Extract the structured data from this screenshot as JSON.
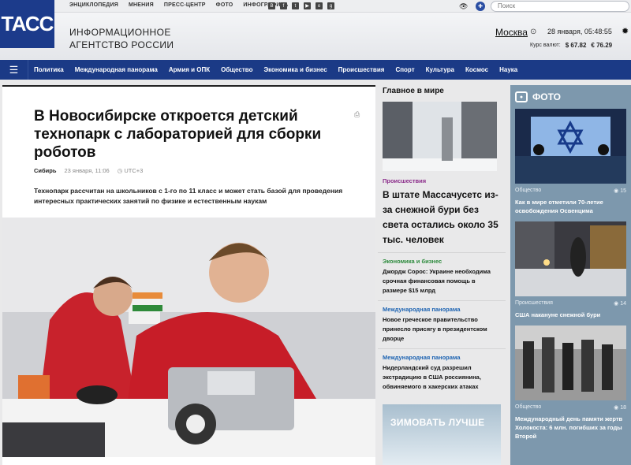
{
  "topbar": {
    "links": [
      "ЭНЦИКЛОПЕДИЯ",
      "МНЕНИЯ",
      "ПРЕСС-ЦЕНТР",
      "ФОТО",
      "ИНФОГРАФИКА"
    ],
    "social_icons": [
      "vk-icon",
      "facebook-icon",
      "twitter-icon",
      "youtube-icon",
      "odnoklassniki-icon",
      "googleplus-icon"
    ],
    "search_placeholder": "Поиск"
  },
  "header": {
    "logo": "ТАСС",
    "agency_line1": "ИНФОРМАЦИОННОЕ",
    "agency_line2": "АГЕНТСТВО РОССИИ",
    "city": "Москва",
    "datetime": "28 января, 05:48:55",
    "rates_label": "Курс валют:",
    "usd": "$ 67.82",
    "eur": "€ 76.29"
  },
  "nav": {
    "items": [
      "Политика",
      "Международная панорама",
      "Армия и ОПК",
      "Общество",
      "Экономика и бизнес",
      "Происшествия",
      "Спорт",
      "Культура",
      "Космос",
      "Наука"
    ]
  },
  "article": {
    "title": "В Новосибирске откроется детский технопарк с лабораторией для сборки роботов",
    "region": "Сибирь",
    "date": "23 января, 11:06",
    "tz": "UTC+3",
    "lead": "Технопарк рассчитан на школьников с 1-го по 11 класс и может стать базой для проведения интересных практических занятий по физике и естественным наукам"
  },
  "world": {
    "title": "Главное в мире",
    "top_category": "Происшествия",
    "top_headline": "В штате Массачусетс из-за снежной бури без света остались около 35 тыс. человек",
    "items": [
      {
        "category": "Экономика и бизнес",
        "headline": "Джордж Сорос: Украине необходима срочная финансовая помощь в размере $15 млрд"
      },
      {
        "category": "Международная панорама",
        "headline": "Новое греческое правительство принесло присягу в президентском дворце"
      },
      {
        "category": "Международная панорама",
        "headline": "Нидерландский суд разрешил экстрадицию в США россиянина, обвиняемого в хакерских атаках"
      }
    ],
    "ad_text": "ЗИМОВАТЬ ЛУЧШЕ"
  },
  "photo": {
    "title": "ФОТО",
    "cards": [
      {
        "category": "Общество",
        "count": "15",
        "caption": "Как в мире отметили 70-летие освобождения Освенцима"
      },
      {
        "category": "Происшествия",
        "count": "14",
        "caption": "США накануне снежной бури"
      },
      {
        "category": "Общество",
        "count": "18",
        "caption": "Международный день памяти жертв Холокоста: 6 млн. погибших за годы Второй"
      }
    ]
  }
}
